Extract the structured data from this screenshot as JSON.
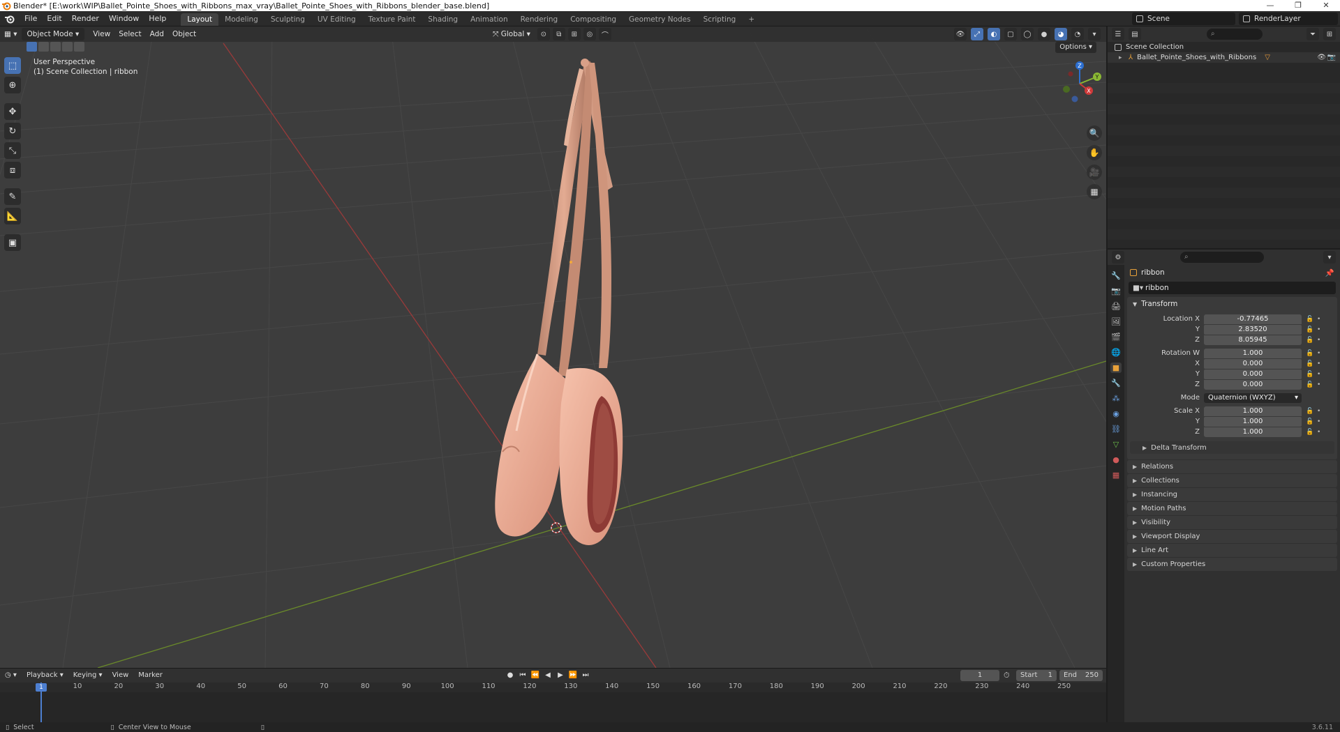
{
  "window": {
    "title": "Blender* [E:\\work\\WIP\\Ballet_Pointe_Shoes_with_Ribbons_max_vray\\Ballet_Pointe_Shoes_with_Ribbons_blender_base.blend]",
    "controls": [
      "—",
      "❐",
      "✕"
    ]
  },
  "menu": [
    "File",
    "Edit",
    "Render",
    "Window",
    "Help"
  ],
  "workspaces": [
    "Layout",
    "Modeling",
    "Sculpting",
    "UV Editing",
    "Texture Paint",
    "Shading",
    "Animation",
    "Rendering",
    "Compositing",
    "Geometry Nodes",
    "Scripting",
    "+"
  ],
  "active_workspace": "Layout",
  "scene": {
    "scene_name": "Scene",
    "render_layer": "RenderLayer"
  },
  "viewport": {
    "mode": "Object Mode",
    "menu": [
      "View",
      "Select",
      "Add",
      "Object"
    ],
    "orientation": "Global",
    "options_label": "Options",
    "info_line1": "User Perspective",
    "info_line2": "(1) Scene Collection | ribbon"
  },
  "gizmo": {
    "x": "X",
    "y": "Y",
    "z": "Z"
  },
  "outliner": {
    "root": "Scene Collection",
    "items": [
      "Ballet_Pointe_Shoes_with_Ribbons"
    ]
  },
  "properties": {
    "object_name": "ribbon",
    "data_name": "ribbon",
    "transform_title": "Transform",
    "location": {
      "label_x": "Location X",
      "label_y": "Y",
      "label_z": "Z",
      "x": "-0.77465",
      "y": "2.83520",
      "z": "8.05945"
    },
    "rotation": {
      "label_w": "Rotation W",
      "label_x": "X",
      "label_y": "Y",
      "label_z": "Z",
      "w": "1.000",
      "x": "0.000",
      "y": "0.000",
      "z": "0.000"
    },
    "mode": {
      "label": "Mode",
      "value": "Quaternion (WXYZ)"
    },
    "scale": {
      "label_x": "Scale X",
      "label_y": "Y",
      "label_z": "Z",
      "x": "1.000",
      "y": "1.000",
      "z": "1.000"
    },
    "delta_transform": "Delta Transform",
    "panels": [
      "Relations",
      "Collections",
      "Instancing",
      "Motion Paths",
      "Visibility",
      "Viewport Display",
      "Line Art",
      "Custom Properties"
    ]
  },
  "timeline": {
    "menu": [
      "Playback",
      "Keying",
      "View",
      "Marker"
    ],
    "current_frame": "1",
    "start_label": "Start",
    "start": "1",
    "end_label": "End",
    "end": "250",
    "ticks": [
      "1",
      "10",
      "20",
      "30",
      "40",
      "50",
      "60",
      "70",
      "80",
      "90",
      "100",
      "110",
      "120",
      "130",
      "140",
      "150",
      "160",
      "170",
      "180",
      "190",
      "200",
      "210",
      "220",
      "230",
      "240",
      "250"
    ]
  },
  "status": {
    "select": "Select",
    "center_view": "Center View to Mouse",
    "version": "3.6.11"
  }
}
